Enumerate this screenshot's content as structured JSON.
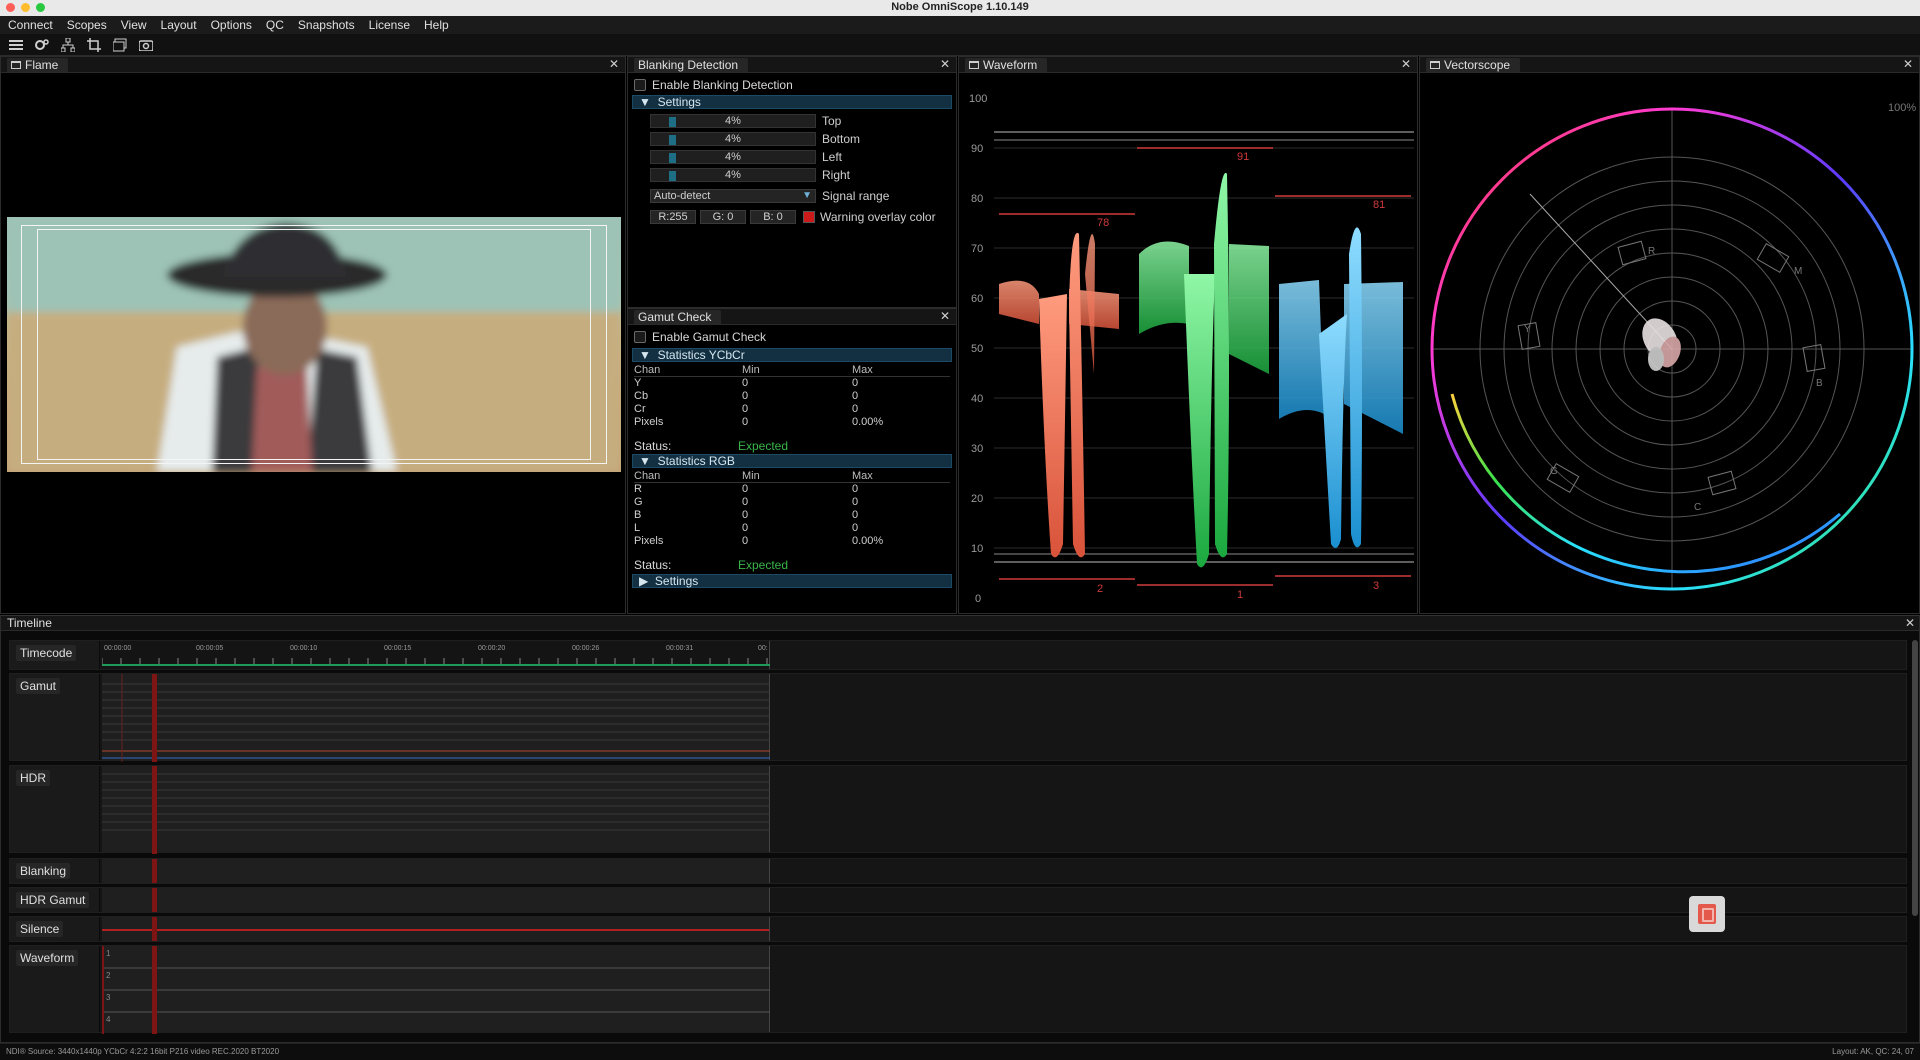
{
  "app": {
    "title": "Nobe OmniScope 1.10.149"
  },
  "menu": [
    "Connect",
    "Scopes",
    "View",
    "Layout",
    "Options",
    "QC",
    "Snapshots",
    "License",
    "Help"
  ],
  "toolbar": {
    "tools": [
      "list-icon",
      "settings-gear-icon",
      "hierarchy-icon",
      "crop-icon",
      "layers-icon",
      "camera-icon"
    ]
  },
  "flame": {
    "tab_label": "Flame"
  },
  "blanking": {
    "tab_label": "Blanking Detection",
    "enable_label": "Enable Blanking Detection",
    "settings_label": "Settings",
    "sliders": [
      {
        "value": "4%",
        "label": "Top"
      },
      {
        "value": "4%",
        "label": "Bottom"
      },
      {
        "value": "4%",
        "label": "Left"
      },
      {
        "value": "4%",
        "label": "Right"
      }
    ],
    "signal_range_value": "Auto-detect",
    "signal_range_label": "Signal range",
    "color_r": "R:255",
    "color_g": "G:  0",
    "color_b": "B:  0",
    "warning_label": "Warning overlay color",
    "warning_color": "#cc1a1a"
  },
  "gamut": {
    "tab_label": "Gamut Check",
    "enable_label": "Enable Gamut Check",
    "ycbcr_label": "Statistics YCbCr",
    "rgb_label": "Statistics RGB",
    "settings_label": "Settings",
    "headers": [
      "Chan",
      "Min",
      "Max"
    ],
    "ycbcr_rows": [
      [
        "Y",
        "0",
        "0"
      ],
      [
        "Cb",
        "0",
        "0"
      ],
      [
        "Cr",
        "0",
        "0"
      ],
      [
        "Pixels",
        "0",
        "0.00%"
      ]
    ],
    "rgb_rows": [
      [
        "R",
        "0",
        "0"
      ],
      [
        "G",
        "0",
        "0"
      ],
      [
        "B",
        "0",
        "0"
      ],
      [
        "L",
        "0",
        "0"
      ],
      [
        "Pixels",
        "0",
        "0.00%"
      ]
    ],
    "status_label": "Status:",
    "status_value": "Expected",
    "status_color": "#39b54a"
  },
  "waveform": {
    "tab_label": "Waveform",
    "scale": [
      "100",
      "90",
      "80",
      "70",
      "60",
      "50",
      "40",
      "30",
      "20",
      "10",
      "0"
    ],
    "peak_labels": [
      "78",
      "91",
      "81"
    ],
    "floor_labels": [
      "2",
      "1",
      "3"
    ],
    "colors": {
      "red": "#f07a5c",
      "green": "#3ee06a",
      "blue": "#3fb8ef"
    }
  },
  "vectorscope": {
    "tab_label": "Vectorscope",
    "zoom_label": "100%",
    "targets": [
      "R",
      "M",
      "B",
      "C",
      "G",
      "Y"
    ]
  },
  "timeline": {
    "title": "Timeline",
    "tracks": [
      "Timecode",
      "Gamut",
      "HDR",
      "Blanking",
      "HDR Gamut",
      "Silence",
      "Waveform"
    ],
    "timecodes": [
      "00:00:00",
      "00:00:05",
      "00:00:10",
      "00:00:15",
      "00:00:20",
      "00:00:26",
      "00:00:31",
      "00:"
    ],
    "waveform_lines": [
      "1",
      "2",
      "3",
      "4"
    ]
  },
  "statusbar": {
    "left": "NDI® Source: 3440x1440p YCbCr 4:2:2 16bit P216 video REC.2020 BT2020",
    "right": "Layout: AK, QC: 24, 07"
  }
}
